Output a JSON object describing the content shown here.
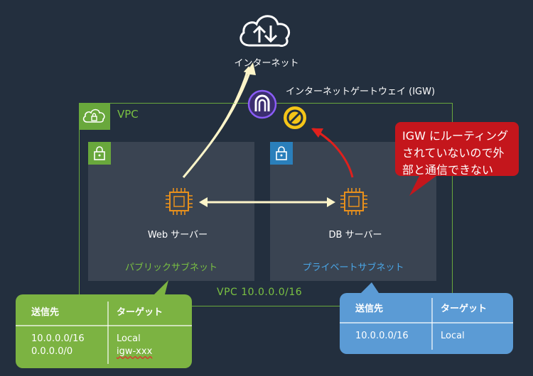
{
  "internet": {
    "label": "インターネット",
    "icon": "cloud-upload-download-icon"
  },
  "igw": {
    "label": "インターネットゲートウェイ (IGW)",
    "icon": "internet-gateway-icon",
    "blocked_icon": "no-entry-icon"
  },
  "vpc": {
    "label": "VPC",
    "cidr": "VPC  10.0.0.0/16",
    "icon": "cloud-icon"
  },
  "public_subnet": {
    "label": "パブリックサブネット",
    "icon": "lock-icon"
  },
  "private_subnet": {
    "label": "プライベートサブネット",
    "icon": "lock-icon"
  },
  "web_server": {
    "label": "Web サーバー",
    "icon": "chip-icon"
  },
  "db_server": {
    "label": "DB サーバー",
    "icon": "chip-icon"
  },
  "callout": {
    "lines": [
      "IGW にルーティング",
      "されていないので外",
      "部と通信できない"
    ]
  },
  "public_route_table": {
    "headers": [
      "送信先",
      "ターゲット"
    ],
    "rows": [
      {
        "destination": "10.0.0.0/16",
        "target": "Local"
      },
      {
        "destination": "0.0.0.0/0",
        "target": "igw-xxx"
      }
    ]
  },
  "private_route_table": {
    "headers": [
      "送信先",
      "ターゲット"
    ],
    "rows": [
      {
        "destination": "10.0.0.0/16",
        "target": "Local"
      }
    ]
  },
  "colors": {
    "background": "#232f3e",
    "vpc_green": "#69a83c",
    "private_blue": "#2a7fbb",
    "chip_orange": "#e8901c",
    "arrow_cream": "#fdf5c9",
    "blocked_red": "#e0201c",
    "callout_red": "#c4161c",
    "table_green": "#7cb342",
    "table_blue": "#5b9bd5",
    "igw_purple": "#8a5cf6",
    "no_entry_yellow": "#f5c518"
  }
}
